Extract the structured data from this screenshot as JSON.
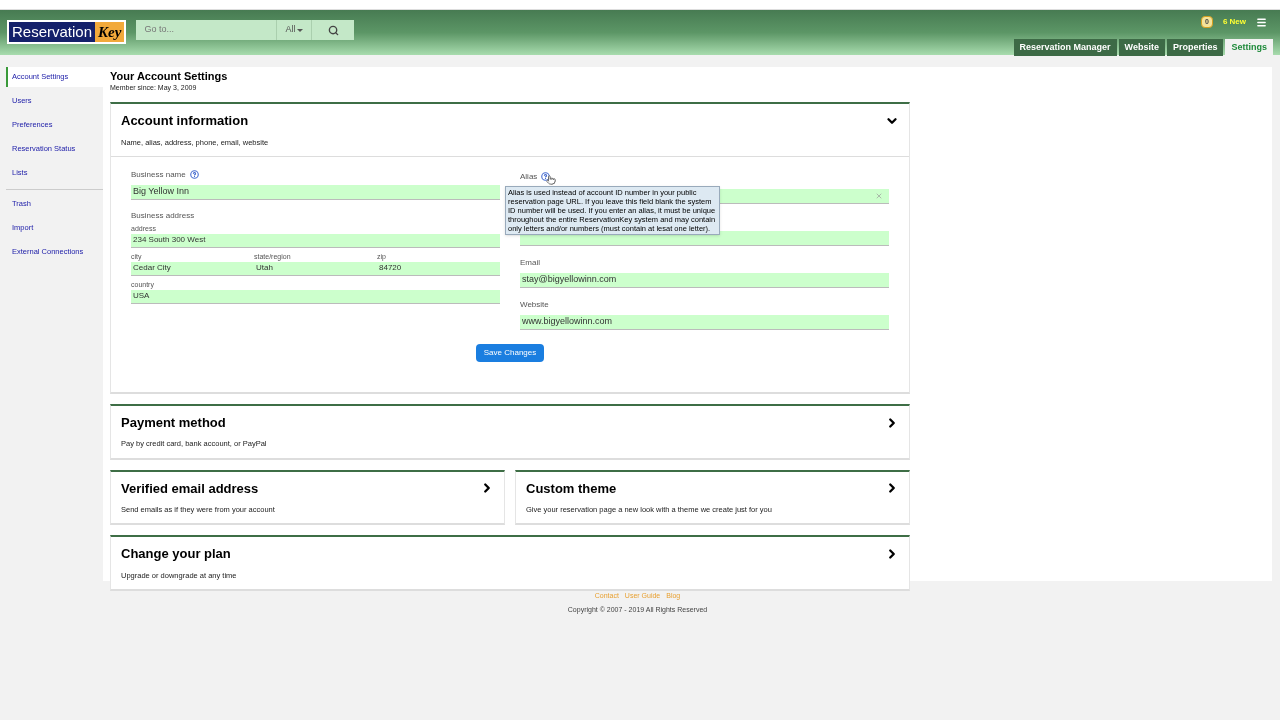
{
  "header": {
    "logo": {
      "word1": "Reservation",
      "word2": "Key"
    },
    "search": {
      "placeholder": "Go to...",
      "scope": "All"
    },
    "notifications": {
      "count": "0",
      "new_label": "6 New"
    },
    "tabs": [
      {
        "label": "Reservation Manager",
        "selected": false
      },
      {
        "label": "Website",
        "selected": false
      },
      {
        "label": "Properties",
        "selected": false
      },
      {
        "label": "Settings",
        "selected": true
      }
    ]
  },
  "sidebar": {
    "groups": [
      [
        {
          "label": "Account Settings",
          "selected": true
        },
        {
          "label": "Users",
          "selected": false
        },
        {
          "label": "Preferences",
          "selected": false
        },
        {
          "label": "Reservation Status",
          "selected": false
        },
        {
          "label": "Lists",
          "selected": false
        }
      ],
      [
        {
          "label": "Trash",
          "selected": false
        },
        {
          "label": "Import",
          "selected": false
        },
        {
          "label": "External Connections",
          "selected": false
        }
      ]
    ]
  },
  "page": {
    "title": "Your Account Settings",
    "subtitle": "Member since: May 3, 2009"
  },
  "account_card": {
    "title": "Account information",
    "description": "Name, alias, address, phone, email, website",
    "expanded": true,
    "business_name": {
      "label": "Business name",
      "value": "Big Yellow Inn",
      "help": true
    },
    "business_address": {
      "label": "Business address",
      "address": {
        "label": "address",
        "value": "234 South  300 West"
      },
      "parts": [
        {
          "label": "city",
          "value": "Cedar City"
        },
        {
          "label": "state/region",
          "value": "Utah"
        },
        {
          "label": "zip",
          "value": "84720"
        }
      ],
      "country": {
        "label": "country",
        "value": "USA"
      }
    },
    "right_fields": [
      {
        "kind": "labeled",
        "label": "Alias",
        "help": true,
        "clearable": true,
        "tooltip": "Alias is used instead of account ID number in your public reservation page URL. If you leave this field blank the system ID number will be used. If you enter an alias, it must be unique throughout the entire ReservationKey system and may contain only letters and/or numbers (must contain at lesat one letter)."
      },
      {
        "kind": "covered"
      },
      {
        "kind": "labeled",
        "label": "Email",
        "value": "stay@bigyellowinn.com"
      },
      {
        "kind": "labeled",
        "label": "Website",
        "value": "www.bigyellowinn.com"
      }
    ],
    "save_button": "Save Changes"
  },
  "card_rows": [
    [
      {
        "title": "Payment method",
        "description": "Pay by credit card, bank account, or PayPal",
        "expanded": false
      }
    ],
    [
      {
        "title": "Verified email address",
        "description": "Send emails as if they were from your account",
        "expanded": false
      },
      {
        "title": "Custom theme",
        "description": "Give your reservation page a new look with a theme we create just for you",
        "expanded": false
      }
    ],
    [
      {
        "title": "Change your plan",
        "description": "Upgrade or downgrade at any time",
        "expanded": false
      }
    ]
  ],
  "footer": {
    "links": [
      "Contact",
      "User Guide",
      "Blog"
    ],
    "copyright": "Copyright © 2007 - 2019 All Rights Reserved"
  }
}
